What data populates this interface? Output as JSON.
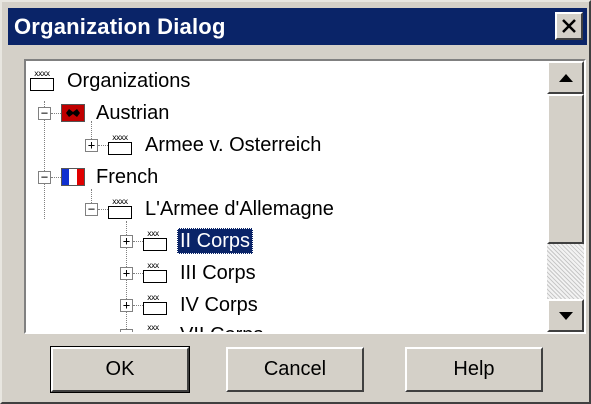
{
  "dialog": {
    "title": "Organization Dialog",
    "close_glyph": "✕"
  },
  "tree": {
    "root_label": "Organizations",
    "nodes": {
      "austrian": {
        "label": "Austrian",
        "expander": "−"
      },
      "armee_osterreich": {
        "label": "Armee v. Osterreich",
        "expander": "+",
        "marks": "xxxx"
      },
      "french": {
        "label": "French",
        "expander": "−"
      },
      "armee_allemagne": {
        "label": "L'Armee d'Allemagne",
        "expander": "−",
        "marks": "xxxx"
      },
      "ii_corps": {
        "label": "II Corps",
        "expander": "+",
        "marks": "xxx",
        "selected": true
      },
      "iii_corps": {
        "label": "III Corps",
        "expander": "+",
        "marks": "xxx"
      },
      "iv_corps": {
        "label": "IV Corps",
        "expander": "+",
        "marks": "xxx"
      },
      "vii_corps": {
        "label": "VII Corps",
        "expander": "+",
        "marks": "xxx"
      }
    },
    "root_marks": "xxxx"
  },
  "buttons": {
    "ok": "OK",
    "cancel": "Cancel",
    "help": "Help"
  },
  "colors": {
    "titlebar": "#0a2468",
    "selection": "#0a2468",
    "face": "#d4d0c8",
    "austria_flag": "#c00000",
    "france_blue": "#1030d0",
    "france_red": "#e00000"
  }
}
